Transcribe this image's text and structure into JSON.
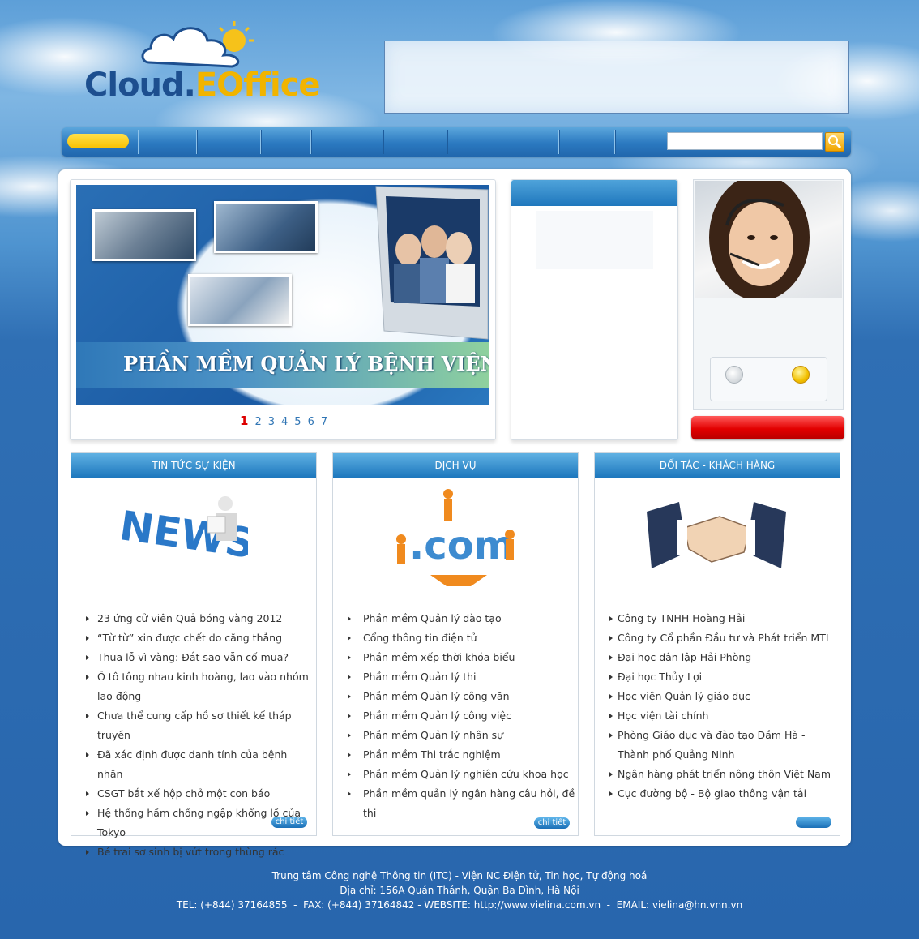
{
  "logo": {
    "part1": "Cloud.",
    "part2": "EOffice"
  },
  "search": {
    "placeholder": ""
  },
  "slider": {
    "caption": "PHẦN MỀM QUẢN LÝ BỆNH VIỆN",
    "pages": [
      "1",
      "2",
      "3",
      "4",
      "5",
      "6",
      "7"
    ],
    "active_page": "1"
  },
  "news": {
    "title": "TIN TỨC SỰ KIỆN",
    "items": [
      "23 ứng cử viên Quả bóng vàng 2012",
      "“Từ từ” xin được chết do căng thẳng",
      "Thua lỗ vì vàng: Đắt sao vẫn cố mua?",
      "Ô tô tông nhau kinh hoàng, lao vào nhóm lao động",
      "Chưa thể cung cấp hồ sơ thiết kế tháp truyền",
      "Đã xác định được danh tính của bệnh nhân",
      "CSGT bắt xế hộp chở một con báo",
      "Hệ thống hầm chống ngập khổng lồ của Tokyo",
      "Bé trai sơ sinh bị vứt trong thùng rác"
    ],
    "more": "chi tiết"
  },
  "services": {
    "title": "DỊCH VỤ",
    "items": [
      "Phần mềm Quản lý đào tạo",
      "Cổng thông tin điện tử",
      "Phần mềm xếp thời khóa biểu",
      "Phần mềm Quản lý thi",
      "Phần mềm Quản lý công văn",
      "Phần mềm Quản lý công việc",
      "Phần mềm Quản lý nhân sự",
      "Phần mềm Thi trắc nghiệm",
      "Phần mềm Quản lý nghiên cứu khoa học",
      "Phần mềm quản lý ngân hàng câu hỏi, đề thi"
    ],
    "more": "chi tiết"
  },
  "partners": {
    "title": "ĐỐI TÁC - KHÁCH HÀNG",
    "items": [
      "Công ty TNHH Hoàng Hải",
      "Công ty Cổ phần Đầu tư và Phát triển MTL",
      "Đại học dân lập Hải Phòng",
      "Đại học Thủy Lợi",
      "Học viện Quản lý giáo dục",
      "Học viện tài chính",
      "Phòng Giáo dục và đào tạo Đầm Hà - Thành phố Quảng Ninh",
      "Ngân hàng phát triển nông thôn Việt Nam",
      "Cục đường bộ - Bộ giao thông vận tải"
    ]
  },
  "footer": {
    "line1": "Trung tâm Công nghệ Thông tin (ITC) - Viện NC Điện tử, Tin học, Tự động hoá",
    "line2": "Địa chỉ: 156A Quán Thánh, Quận Ba Đình, Hà Nội",
    "line3": "TEL: (+844) 37164855  -  FAX: (+844) 37164842 - WEBSITE: http://www.vielina.com.vn  -  EMAIL: vielina@hn.vnn.vn"
  },
  "colors": {
    "accent_blue": "#1f77bd",
    "brand_dark": "#1d4f8f",
    "brand_yellow": "#f1b400",
    "alert_red": "#e20000"
  }
}
